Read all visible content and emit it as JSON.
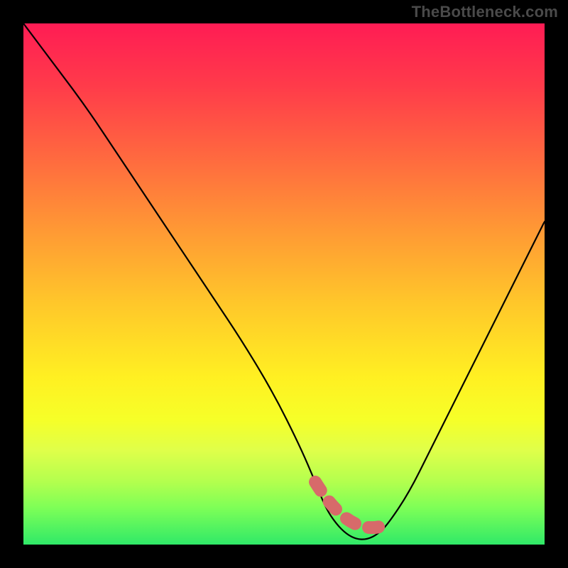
{
  "watermark": "TheBottleneck.com",
  "chart_data": {
    "type": "line",
    "title": "",
    "xlabel": "",
    "ylabel": "",
    "xlim": [
      0,
      100
    ],
    "ylim": [
      0,
      100
    ],
    "series": [
      {
        "name": "bottleneck-curve",
        "x": [
          0,
          6,
          12,
          18,
          24,
          30,
          36,
          42,
          48,
          53,
          56,
          58,
          60,
          62,
          64,
          66,
          68,
          70,
          74,
          78,
          82,
          86,
          90,
          94,
          98,
          100
        ],
        "values": [
          100,
          92,
          84,
          75,
          66,
          57,
          48,
          39,
          29,
          19,
          12,
          7,
          4,
          2,
          1,
          1,
          2,
          4,
          10,
          18,
          26,
          34,
          42,
          50,
          58,
          62
        ]
      }
    ],
    "annotations": {
      "flat_zone_x": [
        56,
        70
      ],
      "flat_zone_marker_color": "#d76a6a"
    },
    "gradient_stops": [
      {
        "pos": 0.0,
        "color": "#ff1c54"
      },
      {
        "pos": 0.12,
        "color": "#ff3b4a"
      },
      {
        "pos": 0.26,
        "color": "#ff6a3f"
      },
      {
        "pos": 0.4,
        "color": "#ff9a34"
      },
      {
        "pos": 0.54,
        "color": "#ffc82a"
      },
      {
        "pos": 0.68,
        "color": "#fff022"
      },
      {
        "pos": 0.76,
        "color": "#f6ff28"
      },
      {
        "pos": 0.82,
        "color": "#dfff4a"
      },
      {
        "pos": 0.88,
        "color": "#b3ff4e"
      },
      {
        "pos": 0.93,
        "color": "#7dff57"
      },
      {
        "pos": 1.0,
        "color": "#30e968"
      }
    ]
  }
}
